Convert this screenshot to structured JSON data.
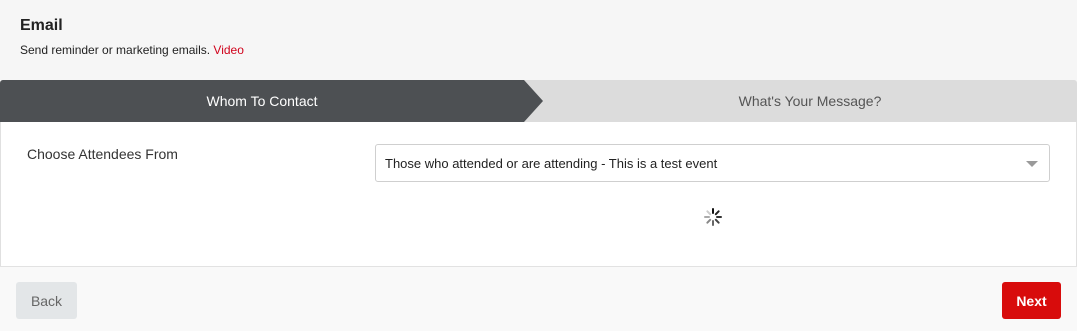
{
  "header": {
    "title": "Email",
    "subtitle": "Send reminder or marketing emails.",
    "video_link": "Video"
  },
  "steps": [
    {
      "label": "Whom To Contact",
      "active": true
    },
    {
      "label": "What's Your Message?",
      "active": false
    }
  ],
  "form": {
    "attendees_label": "Choose Attendees From",
    "attendees_value": "Those who attended or are attending - This is a test event"
  },
  "footer": {
    "back_label": "Back",
    "next_label": "Next"
  },
  "colors": {
    "accent": "#d80c0c",
    "active_step": "#4d5053",
    "inactive_step": "#dcdcdc"
  }
}
